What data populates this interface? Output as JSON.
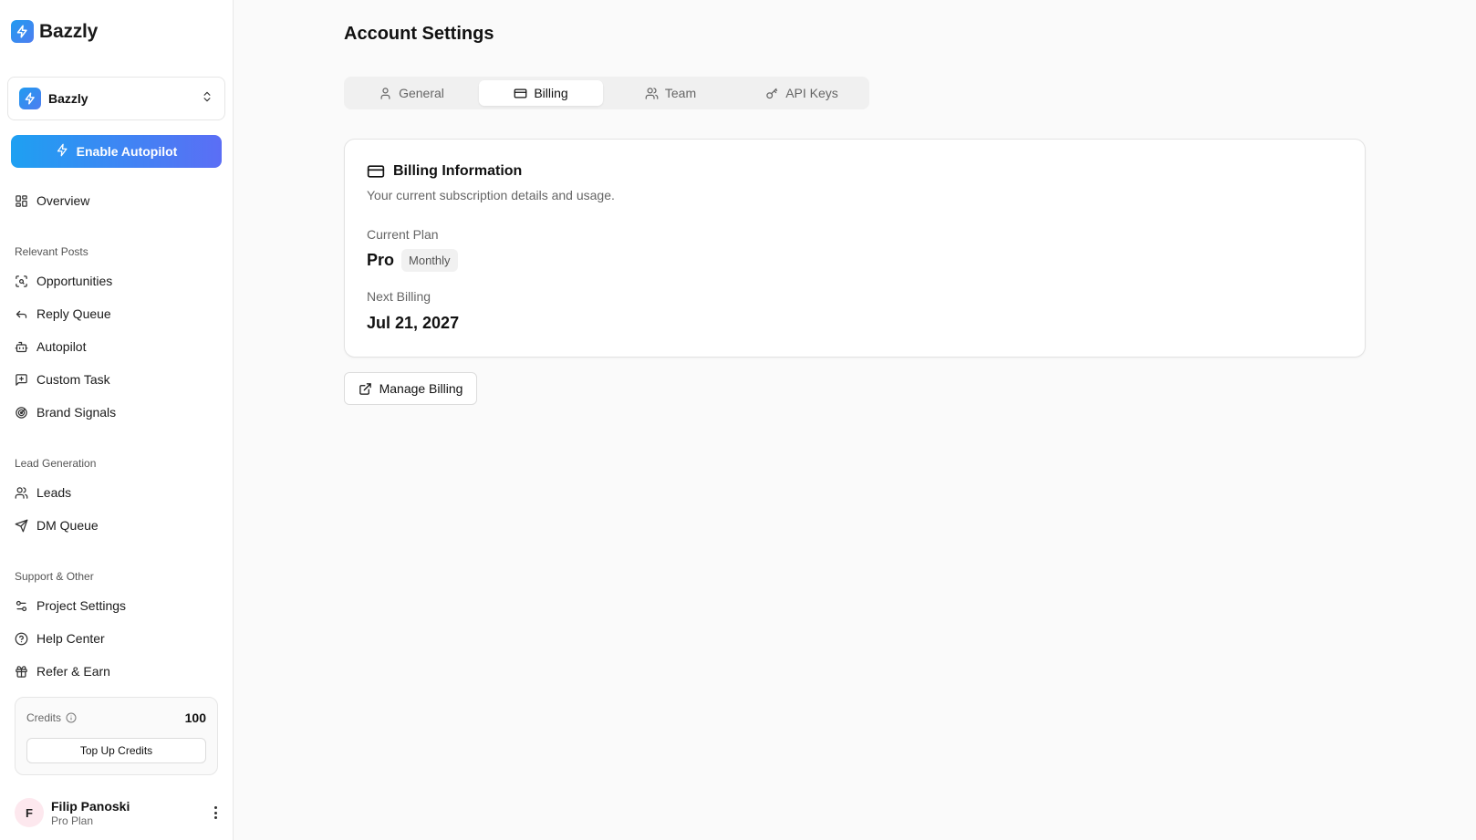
{
  "app": {
    "name": "Bazzly"
  },
  "workspace": {
    "name": "Bazzly"
  },
  "autopilot_button": {
    "label": "Enable Autopilot"
  },
  "nav": {
    "overview": "Overview",
    "sections": [
      {
        "label": "Relevant Posts",
        "items": [
          "Opportunities",
          "Reply Queue",
          "Autopilot",
          "Custom Task",
          "Brand Signals"
        ]
      },
      {
        "label": "Lead Generation",
        "items": [
          "Leads",
          "DM Queue"
        ]
      },
      {
        "label": "Support & Other",
        "items": [
          "Project Settings",
          "Help Center",
          "Refer & Earn"
        ]
      }
    ]
  },
  "credits": {
    "label": "Credits",
    "value": "100",
    "topup_label": "Top Up Credits"
  },
  "user": {
    "initial": "F",
    "name": "Filip Panoski",
    "plan": "Pro Plan"
  },
  "page": {
    "title": "Account Settings"
  },
  "tabs": [
    {
      "label": "General",
      "icon": "user-icon",
      "active": false
    },
    {
      "label": "Billing",
      "icon": "credit-card-icon",
      "active": true
    },
    {
      "label": "Team",
      "icon": "users-icon",
      "active": false
    },
    {
      "label": "API Keys",
      "icon": "key-icon",
      "active": false
    }
  ],
  "billing": {
    "title": "Billing Information",
    "subtitle": "Your current subscription details and usage.",
    "current_plan_label": "Current Plan",
    "plan_name": "Pro",
    "plan_cycle": "Monthly",
    "next_billing_label": "Next Billing",
    "next_billing_date": "Jul 21, 2027"
  },
  "manage_billing": {
    "label": "Manage Billing"
  },
  "colors": {
    "accent_start": "#1ea0f2",
    "accent_end": "#5b6ef5",
    "background": "#fafafa"
  }
}
